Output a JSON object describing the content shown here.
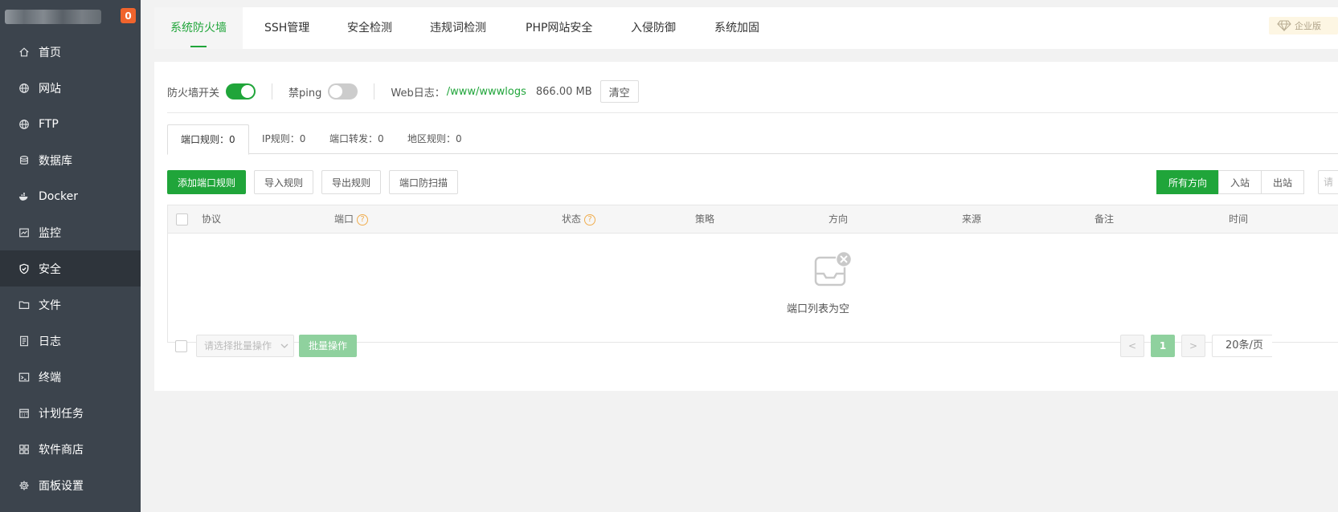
{
  "sidebar": {
    "badge": "0",
    "items": [
      {
        "label": "首页",
        "icon": "home-icon"
      },
      {
        "label": "网站",
        "icon": "globe-icon"
      },
      {
        "label": "FTP",
        "icon": "globe-icon"
      },
      {
        "label": "数据库",
        "icon": "database-icon"
      },
      {
        "label": "Docker",
        "icon": "docker-icon"
      },
      {
        "label": "监控",
        "icon": "monitor-icon"
      },
      {
        "label": "安全",
        "icon": "shield-icon",
        "active": true
      },
      {
        "label": "文件",
        "icon": "folder-icon"
      },
      {
        "label": "日志",
        "icon": "log-icon"
      },
      {
        "label": "终端",
        "icon": "terminal-icon"
      },
      {
        "label": "计划任务",
        "icon": "calendar-icon"
      },
      {
        "label": "软件商店",
        "icon": "apps-icon"
      },
      {
        "label": "面板设置",
        "icon": "gear-icon"
      }
    ]
  },
  "topbar": {
    "tabs": [
      "系统防火墙",
      "SSH管理",
      "安全检测",
      "违规词检测",
      "PHP网站安全",
      "入侵防御",
      "系统加固"
    ],
    "active_tab": "系统防火墙",
    "enterprise_label": "企业版"
  },
  "firewall": {
    "switch_label": "防火墙开关",
    "switch_on": true,
    "ping_label": "禁ping",
    "ping_on": false,
    "weblog_label": "Web日志：",
    "weblog_path": "/www/wwwlogs",
    "weblog_size": "866.00 MB",
    "clear_label": "清空"
  },
  "subtabs": [
    "端口规则：0",
    "IP规则：0",
    "端口转发：0",
    "地区规则：0"
  ],
  "actions": {
    "add_rule": "添加端口规则",
    "import_rule": "导入规则",
    "export_rule": "导出规则",
    "anti_scan": "端口防扫描"
  },
  "direction": {
    "options": [
      "所有方向",
      "入站",
      "出站"
    ],
    "active": "所有方向",
    "search_placeholder": "请"
  },
  "table": {
    "columns": [
      "协议",
      "端口",
      "状态",
      "策略",
      "方向",
      "来源",
      "备注",
      "时间"
    ],
    "help_columns": [
      "端口",
      "状态"
    ],
    "empty_text": "端口列表为空"
  },
  "footer": {
    "batch_placeholder": "请选择批量操作",
    "batch_button": "批量操作",
    "current_page": "1",
    "page_size": "20条/页"
  },
  "colors": {
    "accent": "#20a53a",
    "sidebar_bg": "#3c444d",
    "badge": "#f0642d"
  }
}
